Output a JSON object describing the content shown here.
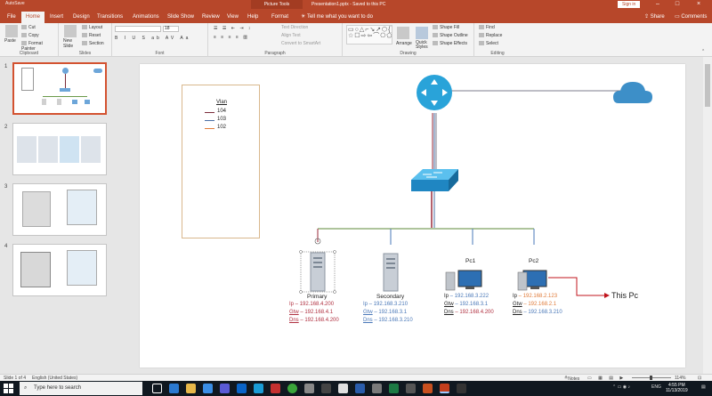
{
  "titlebar": {
    "autosave": "AutoSave",
    "context_tab": "Picture Tools",
    "document": "Presentation1.pptx - Saved to this PC",
    "sign_in": "Sign in"
  },
  "tabs": [
    "File",
    "Home",
    "Insert",
    "Design",
    "Transitions",
    "Animations",
    "Slide Show",
    "Review",
    "View",
    "Help",
    "Format"
  ],
  "active_tab": "Home",
  "tell_me": "Tell me what you want to do",
  "share": "Share",
  "comments": "Comments",
  "ribbon": {
    "clipboard": {
      "paste": "Paste",
      "cut": "Cut",
      "copy": "Copy",
      "format_painter": "Format Painter",
      "label": "Clipboard"
    },
    "slides": {
      "new_slide": "New Slide",
      "layout": "Layout",
      "reset": "Reset",
      "section": "Section",
      "label": "Slides"
    },
    "font": {
      "label": "Font",
      "size": "18"
    },
    "paragraph": {
      "text_direction": "Text Direction",
      "align_text": "Align Text",
      "convert": "Convert to SmartArt",
      "label": "Paragraph"
    },
    "drawing": {
      "arrange": "Arrange",
      "quick_styles": "Quick Styles",
      "shape_fill": "Shape Fill",
      "shape_outline": "Shape Outline",
      "shape_effects": "Shape Effects",
      "label": "Drawing"
    },
    "editing": {
      "find": "Find",
      "replace": "Replace",
      "select": "Select",
      "label": "Editing"
    }
  },
  "thumbnails": [
    "1",
    "2",
    "3",
    "4"
  ],
  "slide": {
    "vlan_title": "Vlan",
    "vlans": [
      {
        "id": "104",
        "color": "#7b2c3a"
      },
      {
        "id": "103",
        "color": "#4a6fa5"
      },
      {
        "id": "102",
        "color": "#e07b39"
      }
    ],
    "servers": [
      {
        "name": "Primary",
        "ip_label": "Ip",
        "ip": "192.168.4.200",
        "gtw_label": "Gtw",
        "gtw": "192.168.4.1",
        "dns_label": "Dns",
        "dns": "192.168.4.200",
        "color": "#b03040"
      },
      {
        "name": "Secondary",
        "ip_label": "Ip",
        "ip": "192.168.3.210",
        "gtw_label": "Gtw",
        "gtw": "192.168.3.1",
        "dns_label": "Dns",
        "dns": "192.168.3.210",
        "color": "#4a78b8"
      }
    ],
    "pcs": [
      {
        "name": "Pc1",
        "ip_label": "Ip",
        "ip": "192.168.3.222",
        "gtw_label": "Gtw",
        "gtw": "192.168.3.1",
        "dns_label": "Dns",
        "dns": "192.168.4.200",
        "ip_color": "#4a78b8",
        "gtw_color": "#4a78b8",
        "dns_color": "#b03040"
      },
      {
        "name": "Pc2",
        "ip_label": "Ip",
        "ip": "192.168.2.123",
        "gtw_label": "Gtw",
        "gtw": "192.168.2.1",
        "dns_label": "Dns",
        "dns": "192.168.3.210",
        "ip_color": "#e07b39",
        "gtw_color": "#e07b39",
        "dns_color": "#4a78b8"
      }
    ],
    "this_pc": "This Pc"
  },
  "statusbar": {
    "slide": "Slide 1 of 4",
    "language": "English (United States)",
    "notes": "Notes",
    "zoom": "114%"
  },
  "taskbar": {
    "search": "Type here to search",
    "lang": "ENG",
    "time": "4:55 PM",
    "date": "11/13/2019"
  },
  "colors": {
    "accent": "#b7472a",
    "router": "#29a3d9",
    "switch": "#2f9ad6",
    "cloud": "#3d8fc8"
  }
}
